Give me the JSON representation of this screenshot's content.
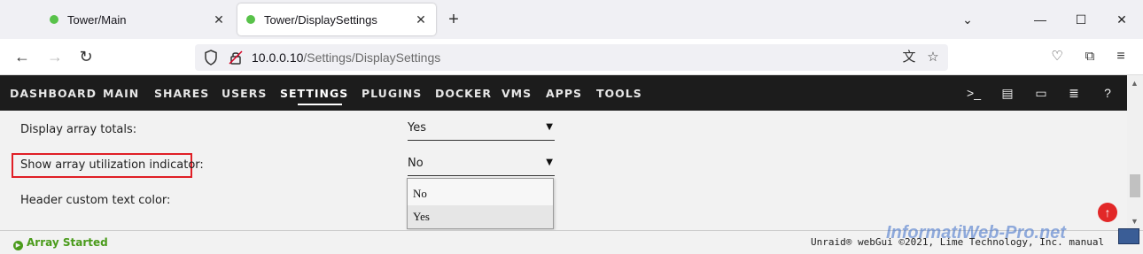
{
  "browser": {
    "tabs": [
      {
        "title": "Tower/Main",
        "active": false
      },
      {
        "title": "Tower/DisplaySettings",
        "active": true
      }
    ],
    "url_host": "10.0.0.10",
    "url_path": "/Settings/DisplaySettings"
  },
  "unraid_nav": {
    "items": [
      "DASHBOARD",
      "MAIN",
      "SHARES",
      "USERS",
      "SETTINGS",
      "PLUGINS",
      "DOCKER",
      "VMS",
      "APPS",
      "TOOLS"
    ],
    "active": "SETTINGS"
  },
  "settings": {
    "rows": [
      {
        "label": "Display array totals:",
        "value": "Yes"
      },
      {
        "label": "Show array utilization indicator:",
        "value": "No"
      },
      {
        "label": "Header custom text color:",
        "value": ""
      }
    ],
    "dropdown_options": [
      "No",
      "Yes"
    ],
    "dropdown_selected": "Yes"
  },
  "footer": {
    "status": "Array Started",
    "copyright": "Unraid® webGui ©2021, Lime Technology, Inc. manual"
  },
  "watermark": "InformatiWeb-Pro.net",
  "colors": {
    "nav_bg": "#1c1c1c",
    "highlight": "#e01f26",
    "status_green": "#4a9b1b",
    "tab_dot": "#58c24a"
  }
}
